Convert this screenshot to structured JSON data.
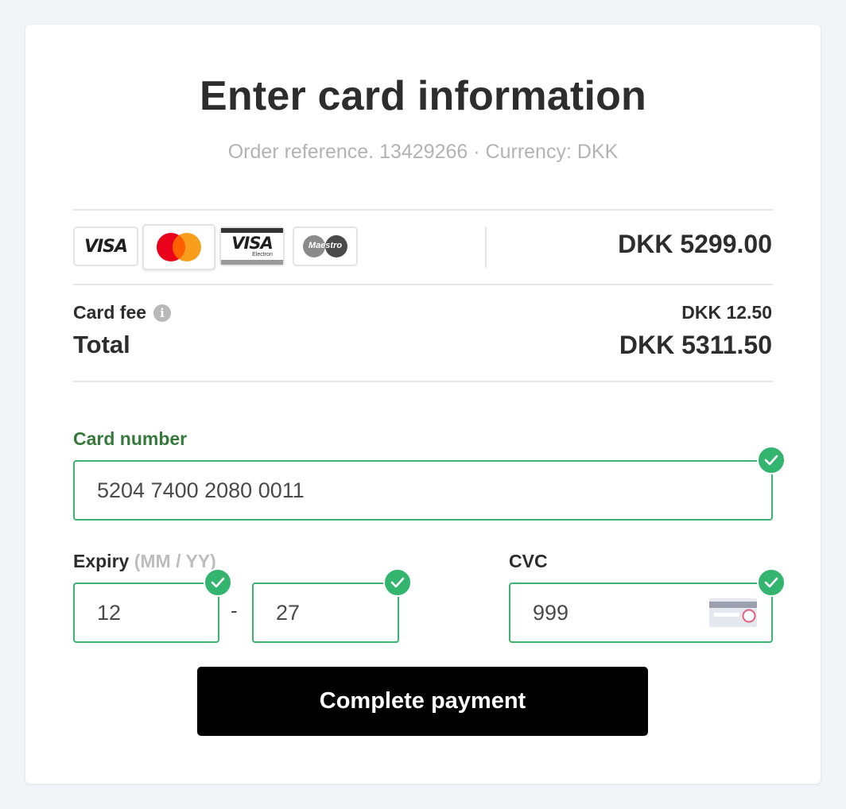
{
  "header": {
    "title": "Enter card information",
    "subtitle": "Order reference. 13429266 · Currency: DKK"
  },
  "payment_methods": [
    {
      "icon": "visa-logo-icon",
      "label": "VISA"
    },
    {
      "icon": "mastercard-logo-icon",
      "label": ""
    },
    {
      "icon": "visa-electron-logo-icon",
      "label": "VISA",
      "sublabel": "Electron"
    },
    {
      "icon": "maestro-logo-icon",
      "label": "Maestro"
    }
  ],
  "order": {
    "amount": "DKK 5299.00",
    "card_fee_label": "Card fee",
    "card_fee_info_icon": "info-icon",
    "card_fee_info_glyph": "i",
    "card_fee_amount": "DKK 12.50",
    "total_label": "Total",
    "total_amount": "DKK 5311.50"
  },
  "form": {
    "card_number_label": "Card number",
    "card_number_value": "5204 7400 2080 0011",
    "expiry_label": "Expiry",
    "expiry_hint": "(MM / YY)",
    "expiry_month": "12",
    "expiry_separator": "-",
    "expiry_year": "27",
    "cvc_label": "CVC",
    "cvc_value": "999",
    "valid_icon": "check-circle-icon"
  },
  "actions": {
    "submit_label": "Complete payment"
  },
  "colors": {
    "accent_green": "#33b56f",
    "label_green": "#357a3a",
    "button_bg": "#000000",
    "page_bg": "#f3f4f8"
  }
}
